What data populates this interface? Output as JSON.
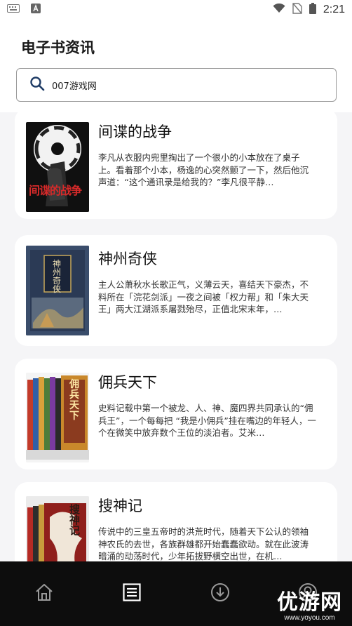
{
  "status_bar": {
    "time": "2:21",
    "icons": [
      "keyboard-icon",
      "a-notification-icon",
      "wifi-icon",
      "no-sim-icon",
      "battery-icon"
    ]
  },
  "header": {
    "title": "电子书资讯"
  },
  "search": {
    "value": "007游戏网",
    "icon": "search-icon"
  },
  "books": [
    {
      "title": "间谍的战争",
      "description": "李凡从衣服内兜里掏出了一个很小的小本放在了桌子上。看着那个小本，杨逸的心突然颤了一下，然后他沉声道：“这个通讯录是给我的？”李凡很平静…",
      "cover_text": "间谍的战争"
    },
    {
      "title": "神州奇侠",
      "description": "主人公萧秋水长歌正气，义薄云天，喜结天下豪杰，不料所在「浣花剑派」一夜之间被「权力帮」和「朱大天王」两大江湖派系屠戮殆尽，正值北宋末年，…",
      "cover_text": "神州奇侠"
    },
    {
      "title": "佣兵天下",
      "description": "史料记载中第一个被龙、人、神、魔四界共同承认的“佣兵王”，一个每每把 “我是小佣兵”挂在嘴边的年轻人，一个在微笑中放弃数个王位的淡泊者。艾米…",
      "cover_text": "佣兵天下"
    },
    {
      "title": "搜神记",
      "description": "传说中的三皇五帝时的洪荒时代，随着天下公认的领袖神农氏的去世，各族群雄都开始蠢蠢欲动。就在此波涛暗涌的动荡时代，少年拓拔野横空出世，在机…",
      "cover_text": "搜神记"
    }
  ],
  "bottom_nav": {
    "items": [
      "home-icon",
      "list-icon",
      "download-icon",
      "profile-icon"
    ]
  },
  "watermark": {
    "main": "优游网",
    "sub": "www.yoyou.com"
  },
  "colors": {
    "background": "#f5f5f7",
    "card": "#ffffff",
    "nav_bar": "#0d0d0d"
  }
}
